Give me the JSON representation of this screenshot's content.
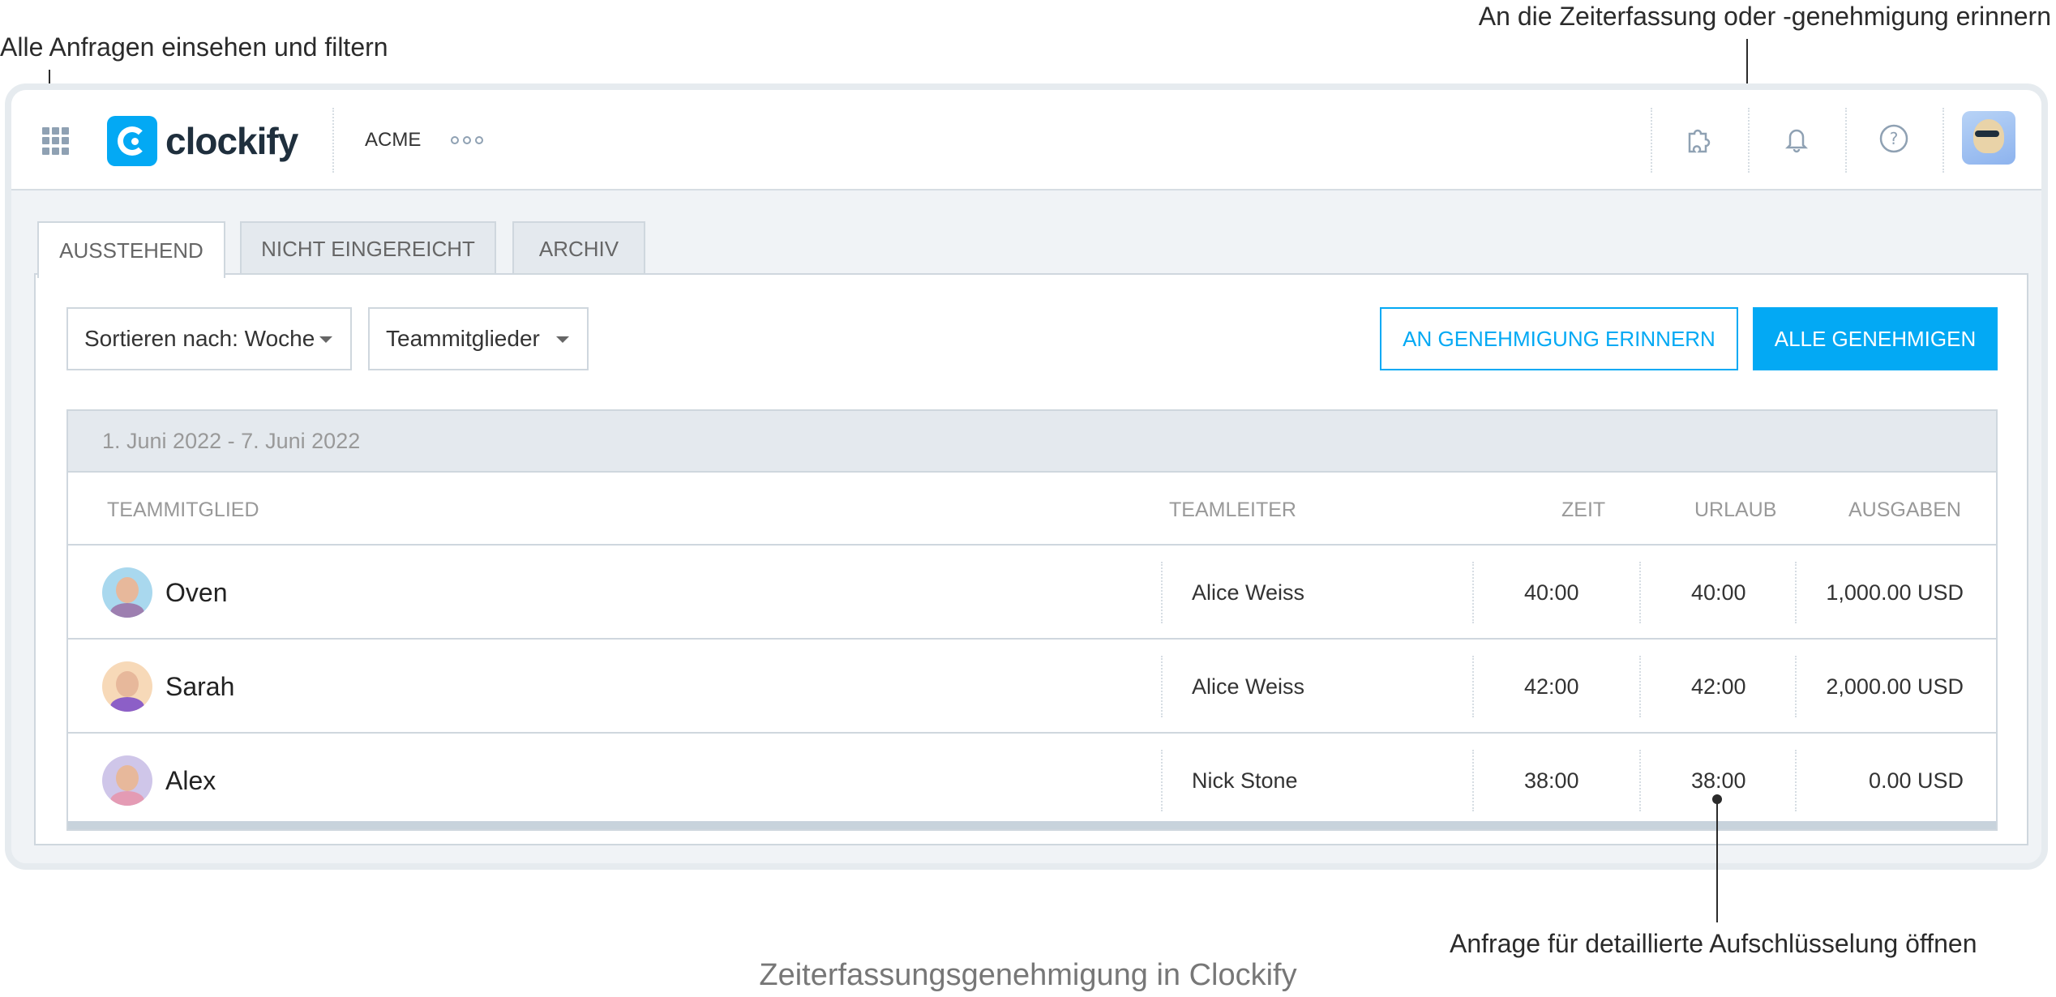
{
  "callouts": {
    "top_left": "Alle Anfragen einsehen und filtern",
    "top_right": "An die Zeiterfassung oder -genehmigung erinnern",
    "bottom_right": "Anfrage für detaillierte Aufschlüsselung öffnen"
  },
  "caption": "Zeiterfassungsgenehmigung in Clockify",
  "topbar": {
    "logo": "clockify",
    "workspace": "ACME",
    "icons": [
      "apps-grid-icon",
      "more-dots-icon",
      "puzzle-icon",
      "bell-icon",
      "help-icon"
    ]
  },
  "tabs": [
    "AUSSTEHEND",
    "NICHT EINGEREICHT",
    "ARCHIV"
  ],
  "filters": {
    "sort": "Sortieren nach: Woche",
    "team": "Teammitglieder"
  },
  "buttons": {
    "remind": "AN GENEHMIGUNG ERINNERN",
    "approve_all": "ALLE GENEHMIGEN"
  },
  "table": {
    "week": "1. Juni 2022 - 7. Juni 2022",
    "headers": [
      "TEAMMITGLIED",
      "TEAMLEITER",
      "ZEIT",
      "URLAUB",
      "AUSGABEN"
    ],
    "rows": [
      {
        "member": "Oven",
        "lead": "Alice Weiss",
        "time": "40:00",
        "leave": "40:00",
        "expenses": "1,000.00 USD"
      },
      {
        "member": "Sarah",
        "lead": "Alice Weiss",
        "time": "42:00",
        "leave": "42:00",
        "expenses": "2,000.00 USD"
      },
      {
        "member": "Alex",
        "lead": "Nick Stone",
        "time": "38:00",
        "leave": "38:00",
        "expenses": "0.00 USD"
      }
    ]
  },
  "colors": {
    "accent": "#03a9f4",
    "border": "#cfd7de"
  }
}
